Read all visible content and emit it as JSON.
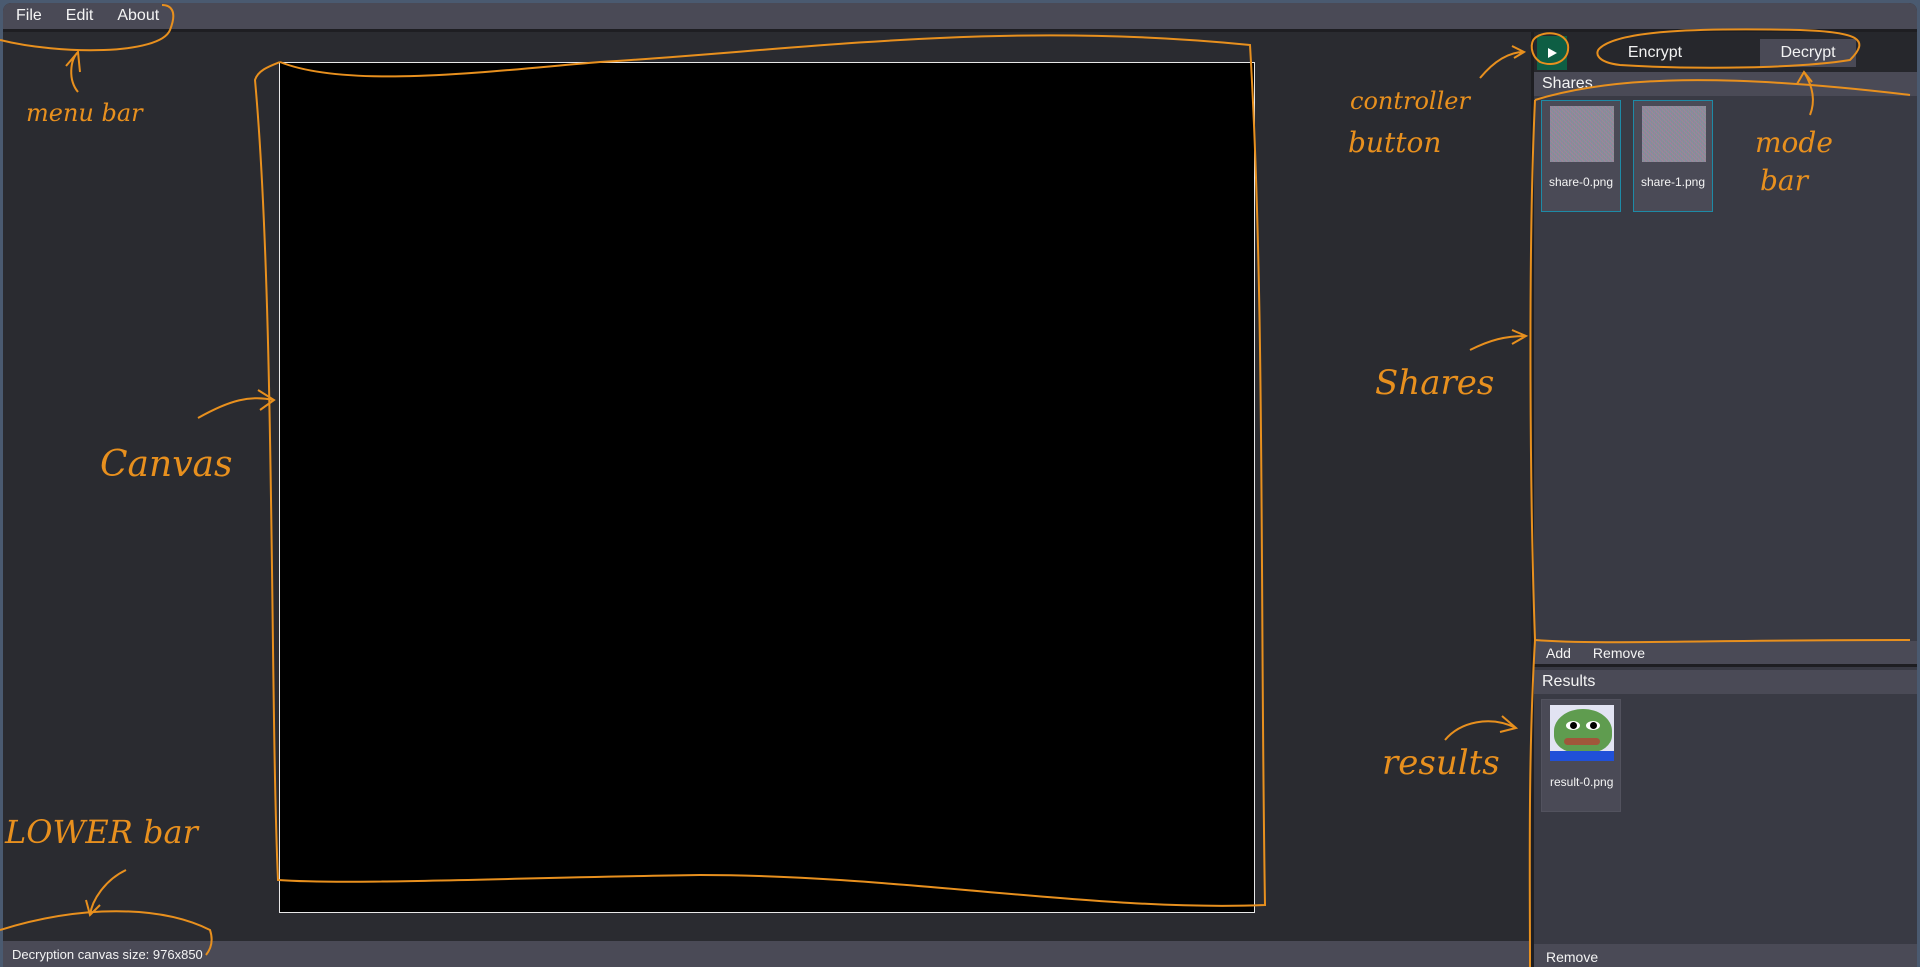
{
  "menubar": {
    "items": [
      "File",
      "Edit",
      "About"
    ]
  },
  "mode_bar": {
    "run_button_icon": "play-icon",
    "modes": [
      "Encrypt",
      "Decrypt"
    ],
    "selected_mode": "Decrypt"
  },
  "shares": {
    "header": "Shares",
    "items": [
      {
        "label": "share-0.png"
      },
      {
        "label": "share-1.png"
      }
    ],
    "actions": [
      "Add",
      "Remove"
    ]
  },
  "results": {
    "header": "Results",
    "items": [
      {
        "label": "result-0.png"
      }
    ],
    "actions": [
      "Remove"
    ]
  },
  "statusbar": {
    "text": "Decryption canvas size: 976x850"
  },
  "annotations": {
    "menu_bar": "menu bar",
    "canvas": "Canvas",
    "lower_bar": "LOWER bar",
    "controller_button": [
      "controller",
      "button"
    ],
    "shares": "Shares",
    "mode_bar": [
      "mode",
      "bar"
    ],
    "results": "results"
  },
  "colors": {
    "accent_run": "#0e5e44",
    "share_border": "#1e8aa6",
    "annotation": "#e8901e"
  }
}
